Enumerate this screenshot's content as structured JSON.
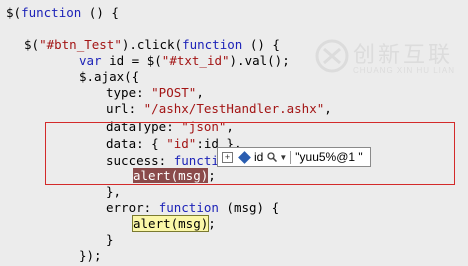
{
  "code": {
    "l1": {
      "a": "$(",
      "kw": "function",
      "b": " () {"
    },
    "l2": {
      "a": "$(",
      "str": "\"#btn_Test\"",
      "b": ").click(",
      "kw": "function",
      "c": " () {"
    },
    "l3": {
      "kw": "var",
      "a": " id = $(",
      "str": "\"#txt_id\"",
      "b": ").val();"
    },
    "l4": {
      "a": "$.ajax({"
    },
    "l5": {
      "a": "type: ",
      "str": "\"POST\"",
      "b": ","
    },
    "l6": {
      "a": "url: ",
      "str": "\"/ashx/TestHandler.ashx\"",
      "b": ","
    },
    "l7": {
      "a": "dataType: ",
      "str": "\"json\"",
      "b": ","
    },
    "l8": {
      "a": "data: { ",
      "str": "\"id\"",
      "b": ":id },"
    },
    "l9": {
      "a": "success: ",
      "kw": "functio"
    },
    "l10": {
      "hl": "alert(msg)",
      "b": ";"
    },
    "l11": {
      "a": "},"
    },
    "l12": {
      "a": "error: ",
      "kw": "function",
      "b": " (msg) {"
    },
    "l13": {
      "hl": "alert(msg)",
      "b": ";"
    },
    "l14": {
      "a": "}"
    },
    "l15": {
      "a": "});"
    }
  },
  "tooltip": {
    "expand": "+",
    "name": "id",
    "value": "\"yuu5%@1 \""
  },
  "watermark": {
    "logo": "创新互联",
    "sub": "CHUANG XIN HU LIAN"
  },
  "colors": {
    "keyword": "#1d23b8",
    "string": "#a31515",
    "breakpoint_box": "#d32a2a"
  }
}
